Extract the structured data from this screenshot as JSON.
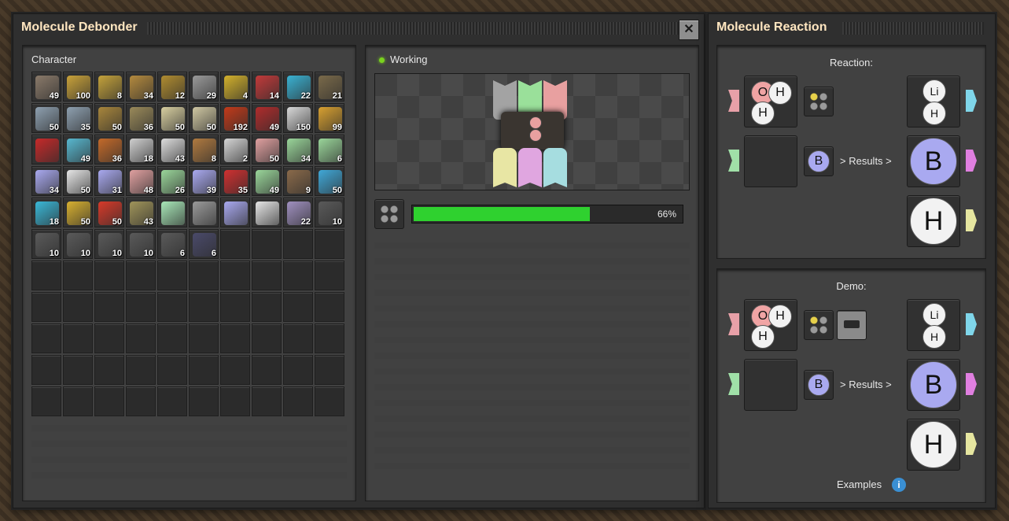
{
  "windows": {
    "debonder": {
      "title": "Molecule Debonder",
      "close_label": "✕",
      "inventory": {
        "title": "Character",
        "rows": [
          [
            {
              "icon": "fence-icon",
              "count": "49",
              "color": "#8a7a6a"
            },
            {
              "icon": "belt-icon",
              "count": "100",
              "color": "#c9a23a"
            },
            {
              "icon": "belt-icon",
              "count": "8",
              "color": "#c4a23b"
            },
            {
              "icon": "armor-icon",
              "count": "34",
              "color": "#b48a3e"
            },
            {
              "icon": "splitter-icon",
              "count": "12",
              "color": "#b08c30"
            },
            {
              "icon": "pipe-icon",
              "count": "29",
              "color": "#9a9a9a"
            },
            {
              "icon": "inserter-icon",
              "count": "4",
              "color": "#d3b12c"
            },
            {
              "icon": "inserter-icon",
              "count": "14",
              "color": "#c23a3a"
            },
            {
              "icon": "inserter-icon",
              "count": "22",
              "color": "#3ab2d3"
            },
            {
              "icon": "pole-icon",
              "count": "21",
              "color": "#7a6a4a"
            }
          ],
          [
            {
              "icon": "tower-icon",
              "count": "50",
              "color": "#8ea0b0"
            },
            {
              "icon": "tower-icon",
              "count": "35",
              "color": "#8ea0b0"
            },
            {
              "icon": "rock-icon",
              "count": "50",
              "color": "#a8863c"
            },
            {
              "icon": "rock-icon",
              "count": "36",
              "color": "#9a8a5a"
            },
            {
              "icon": "gear-cluster-icon",
              "count": "50",
              "color": "#d8cfa0"
            },
            {
              "icon": "gear-cluster-icon",
              "count": "50",
              "color": "#cfc7a2"
            },
            {
              "icon": "cable-icon",
              "count": "192",
              "color": "#c23a1a"
            },
            {
              "icon": "book-icon",
              "count": "49",
              "color": "#b02c2c"
            },
            {
              "icon": "molecule-icon",
              "count": "150",
              "color": "#d8d8d8"
            },
            {
              "icon": "tools-icon",
              "count": "99",
              "color": "#d8a030"
            }
          ],
          [
            {
              "icon": "box-icon",
              "count": "",
              "color": "#c62a2a"
            },
            {
              "icon": "glass-icon",
              "count": "49",
              "color": "#58b8d0"
            },
            {
              "icon": "machine-icon",
              "count": "36",
              "color": "#c46a2a"
            },
            {
              "icon": "gear-icon",
              "count": "18",
              "color": "#cfcfcf"
            },
            {
              "icon": "molecule-icon",
              "count": "43",
              "color": "#dcdcdc"
            },
            {
              "icon": "machine-icon",
              "count": "8",
              "color": "#b07a40"
            },
            {
              "icon": "molecule-icon",
              "count": "2",
              "color": "#d5d5d5"
            },
            {
              "icon": "molecule-icon",
              "count": "50",
              "color": "#e0a0a0"
            },
            {
              "icon": "molecule-icon",
              "count": "34",
              "color": "#9ad69a"
            },
            {
              "icon": "molecule-icon",
              "count": "6",
              "color": "#9ad69a"
            }
          ],
          [
            {
              "icon": "molecule-icon",
              "count": "34",
              "color": "#a9a9f0"
            },
            {
              "icon": "molecule-icon",
              "count": "50",
              "color": "#e6e6e6"
            },
            {
              "icon": "molecule-icon",
              "count": "31",
              "color": "#a9a9f0"
            },
            {
              "icon": "molecule-icon",
              "count": "48",
              "color": "#e0a0a0"
            },
            {
              "icon": "molecule-icon",
              "count": "26",
              "color": "#9ad69a"
            },
            {
              "icon": "molecule-icon",
              "count": "39",
              "color": "#a9a9f0"
            },
            {
              "icon": "blocked-molecule-icon",
              "count": "35",
              "color": "#d03030"
            },
            {
              "icon": "molecule-icon",
              "count": "49",
              "color": "#9ad69a"
            },
            {
              "icon": "spider-icon",
              "count": "9",
              "color": "#8a6a4a"
            },
            {
              "icon": "machine-icon",
              "count": "50",
              "color": "#40a8d8"
            }
          ],
          [
            {
              "icon": "crate-icon",
              "count": "18",
              "color": "#3ab8d8"
            },
            {
              "icon": "crate-icon",
              "count": "50",
              "color": "#d8b030"
            },
            {
              "icon": "crate-icon",
              "count": "50",
              "color": "#d83a2a"
            },
            {
              "icon": "drill-icon",
              "count": "43",
              "color": "#a0945a"
            },
            {
              "icon": "helium-icon",
              "count": "",
              "color": "#a8e8b8"
            },
            {
              "icon": "atom-grid-icon",
              "count": "",
              "color": "#9a9a9a"
            },
            {
              "icon": "molecule-icon",
              "count": "",
              "color": "#a9a9f0"
            },
            {
              "icon": "molecule-icon",
              "count": "",
              "color": "#e6e6e6"
            },
            {
              "icon": "creature-icon",
              "count": "22",
              "color": "#a090c0"
            },
            {
              "icon": "chest-icon",
              "count": "10",
              "color": "#5a5a5a"
            }
          ],
          [
            {
              "icon": "chest-icon",
              "count": "10",
              "color": "#5a5a5a"
            },
            {
              "icon": "chest-icon",
              "count": "10",
              "color": "#5a5a5a"
            },
            {
              "icon": "chest-icon",
              "count": "10",
              "color": "#5a5a5a"
            },
            {
              "icon": "chest-icon",
              "count": "10",
              "color": "#5a5a5a"
            },
            {
              "icon": "chest-icon",
              "count": "6",
              "color": "#5a5a5a"
            },
            {
              "icon": "tank-icon",
              "count": "6",
              "color": "#4a4a6a"
            },
            {
              "empty": true
            },
            {
              "empty": true
            },
            {
              "empty": true
            },
            {
              "empty": true
            }
          ]
        ],
        "empty_rows": 5
      },
      "machine": {
        "status": "Working",
        "status_color": "#7ad31e",
        "progress_value": 0.66,
        "progress_text": "66%",
        "progress_color": "#2fd12f",
        "input_flags": [
          {
            "color": "#a3a3a3"
          },
          {
            "color": "#9ae09a"
          },
          {
            "color": "#e8a0a0"
          }
        ],
        "output_flags": [
          {
            "color": "#e8e6a4"
          },
          {
            "color": "#e0a6e0"
          },
          {
            "color": "#a6dde0"
          }
        ]
      }
    },
    "reaction": {
      "title": "Molecule Reaction",
      "sections": [
        {
          "heading": "Reaction:",
          "reactant_atoms": [
            "O",
            "H",
            "H"
          ],
          "second_input": "B",
          "results_label": "> Results >",
          "products": [
            {
              "atoms": [
                "Li",
                "H"
              ],
              "tab_color": "#7fd6ea"
            },
            {
              "atoms": [
                "B"
              ],
              "tab_color": "#e07fe0",
              "fill": "#a9a9f0"
            },
            {
              "atoms": [
                "H"
              ],
              "tab_color": "#e6e6a0",
              "fill": "#f2f2f2"
            }
          ]
        },
        {
          "heading": "Demo:",
          "reactant_atoms": [
            "O",
            "H",
            "H"
          ],
          "second_input": "B",
          "results_label": "> Results >",
          "products": [
            {
              "atoms": [
                "Li",
                "H"
              ],
              "tab_color": "#7fd6ea"
            },
            {
              "atoms": [
                "B"
              ],
              "tab_color": "#e07fe0",
              "fill": "#a9a9f0"
            },
            {
              "atoms": [
                "H"
              ],
              "tab_color": "#e6e6a0",
              "fill": "#f2f2f2"
            }
          ],
          "footer_label": "Examples",
          "footer_icon": "info-icon"
        }
      ],
      "input_tab_colors": [
        "#e8a0a8",
        "#a0e0a8"
      ]
    }
  }
}
